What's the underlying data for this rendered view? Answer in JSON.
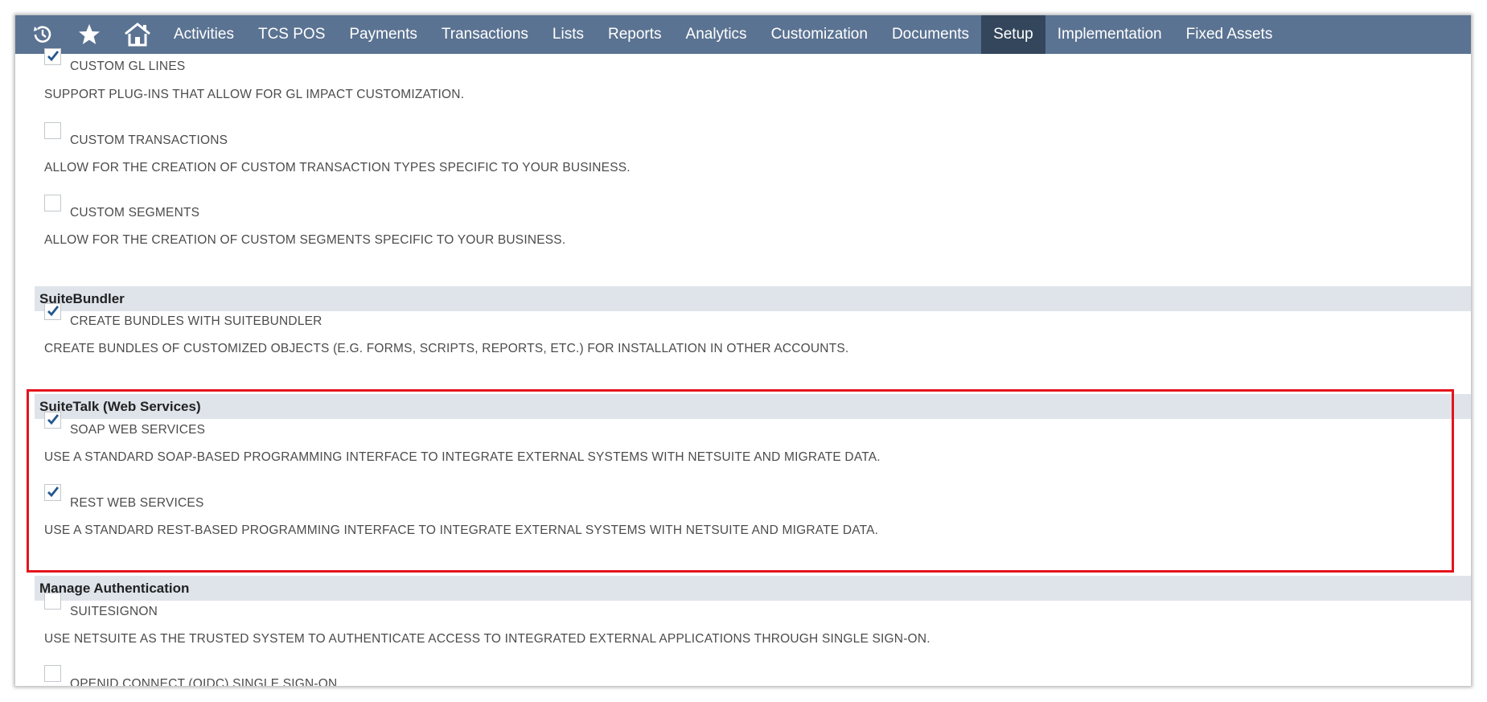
{
  "nav": {
    "icons": [
      "recent-records-icon",
      "star-icon",
      "home-icon"
    ],
    "items": [
      "Activities",
      "TCS POS",
      "Payments",
      "Transactions",
      "Lists",
      "Reports",
      "Analytics",
      "Customization",
      "Documents",
      "Setup",
      "Implementation",
      "Fixed Assets"
    ],
    "active_item": "Setup",
    "colors": {
      "bar": "#5b7392",
      "active": "#33465c"
    }
  },
  "features": {
    "custom_gl": {
      "label": "CUSTOM GL LINES",
      "checked": true,
      "desc": "SUPPORT PLUG-INS THAT ALLOW FOR GL IMPACT CUSTOMIZATION."
    },
    "custom_transactions": {
      "label": "CUSTOM TRANSACTIONS",
      "checked": false,
      "desc": "ALLOW FOR THE CREATION OF CUSTOM TRANSACTION TYPES SPECIFIC TO YOUR BUSINESS."
    },
    "custom_segments": {
      "label": "CUSTOM SEGMENTS",
      "checked": false,
      "desc": "ALLOW FOR THE CREATION OF CUSTOM SEGMENTS SPECIFIC TO YOUR BUSINESS."
    }
  },
  "suitebundler": {
    "title": "SuiteBundler",
    "create_bundles": {
      "label": "CREATE BUNDLES WITH SUITEBUNDLER",
      "checked": true,
      "desc": "CREATE BUNDLES OF CUSTOMIZED OBJECTS (E.G. FORMS, SCRIPTS, REPORTS, ETC.) FOR INSTALLATION IN OTHER ACCOUNTS."
    }
  },
  "suitetalk": {
    "title": "SuiteTalk (Web Services)",
    "soap": {
      "label": "SOAP WEB SERVICES",
      "checked": true,
      "desc": "USE A STANDARD SOAP-BASED PROGRAMMING INTERFACE TO INTEGRATE EXTERNAL SYSTEMS WITH NETSUITE AND MIGRATE DATA."
    },
    "rest": {
      "label": "REST WEB SERVICES",
      "checked": true,
      "desc": "USE A STANDARD REST-BASED PROGRAMMING INTERFACE TO INTEGRATE EXTERNAL SYSTEMS WITH NETSUITE AND MIGRATE DATA."
    },
    "highlight_color": "#e4141c"
  },
  "manage_auth": {
    "title": "Manage Authentication",
    "suitesignon": {
      "label": "SUITESIGNON",
      "checked": false,
      "desc": "USE NETSUITE AS THE TRUSTED SYSTEM TO AUTHENTICATE ACCESS TO INTEGRATED EXTERNAL APPLICATIONS THROUGH SINGLE SIGN-ON."
    },
    "oidc": {
      "label": "OPENID CONNECT (OIDC) SINGLE SIGN-ON",
      "checked": false
    }
  }
}
